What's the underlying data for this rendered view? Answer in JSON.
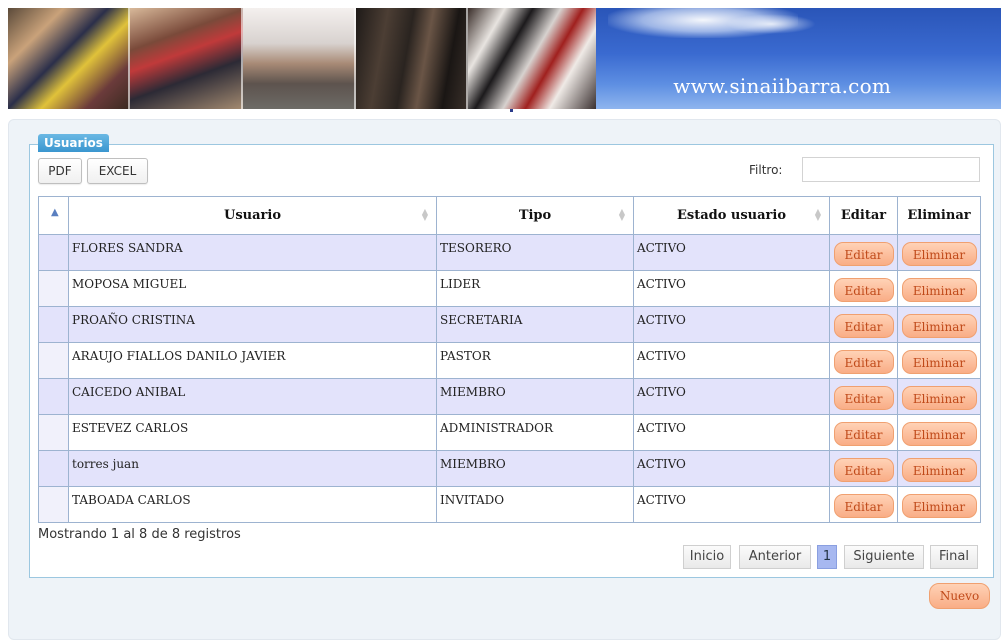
{
  "header": {
    "site_url": "www.sinaiibarra.com"
  },
  "panel": {
    "legend": "Usuarios"
  },
  "toolbar": {
    "pdf_label": "PDF",
    "excel_label": "EXCEL",
    "filter_label": "Filtro:",
    "filter_value": ""
  },
  "table": {
    "columns": [
      "",
      "Usuario",
      "Tipo",
      "Estado usuario",
      "Editar",
      "Eliminar"
    ],
    "edit_label": "Editar",
    "delete_label": "Eliminar",
    "rows": [
      {
        "usuario": "FLORES SANDRA",
        "tipo": "TESORERO",
        "estado": "ACTIVO"
      },
      {
        "usuario": "MOPOSA MIGUEL",
        "tipo": "LIDER",
        "estado": "ACTIVO"
      },
      {
        "usuario": "PROAÑO CRISTINA",
        "tipo": "SECRETARIA",
        "estado": "ACTIVO"
      },
      {
        "usuario": "ARAUJO FIALLOS DANILO JAVIER",
        "tipo": "PASTOR",
        "estado": "ACTIVO"
      },
      {
        "usuario": "CAICEDO ANIBAL",
        "tipo": "MIEMBRO",
        "estado": "ACTIVO"
      },
      {
        "usuario": "ESTEVEZ CARLOS",
        "tipo": "ADMINISTRADOR",
        "estado": "ACTIVO"
      },
      {
        "usuario": "torres juan",
        "tipo": "MIEMBRO",
        "estado": "ACTIVO"
      },
      {
        "usuario": "TABOADA CARLOS",
        "tipo": "INVITADO",
        "estado": "ACTIVO"
      }
    ]
  },
  "footer": {
    "showing_text": "Mostrando 1 al 8 de 8 registros",
    "pagination": {
      "first": "Inicio",
      "previous": "Anterior",
      "current_page": "1",
      "next": "Siguiente",
      "last": "Final"
    },
    "new_label": "Nuevo"
  },
  "colors": {
    "legend_bg": "#3a96cf",
    "row_odd": "#e3e3fb",
    "action_button": "#f9ad86",
    "action_text": "#c04a1a",
    "current_page": "#a7b8f0"
  }
}
